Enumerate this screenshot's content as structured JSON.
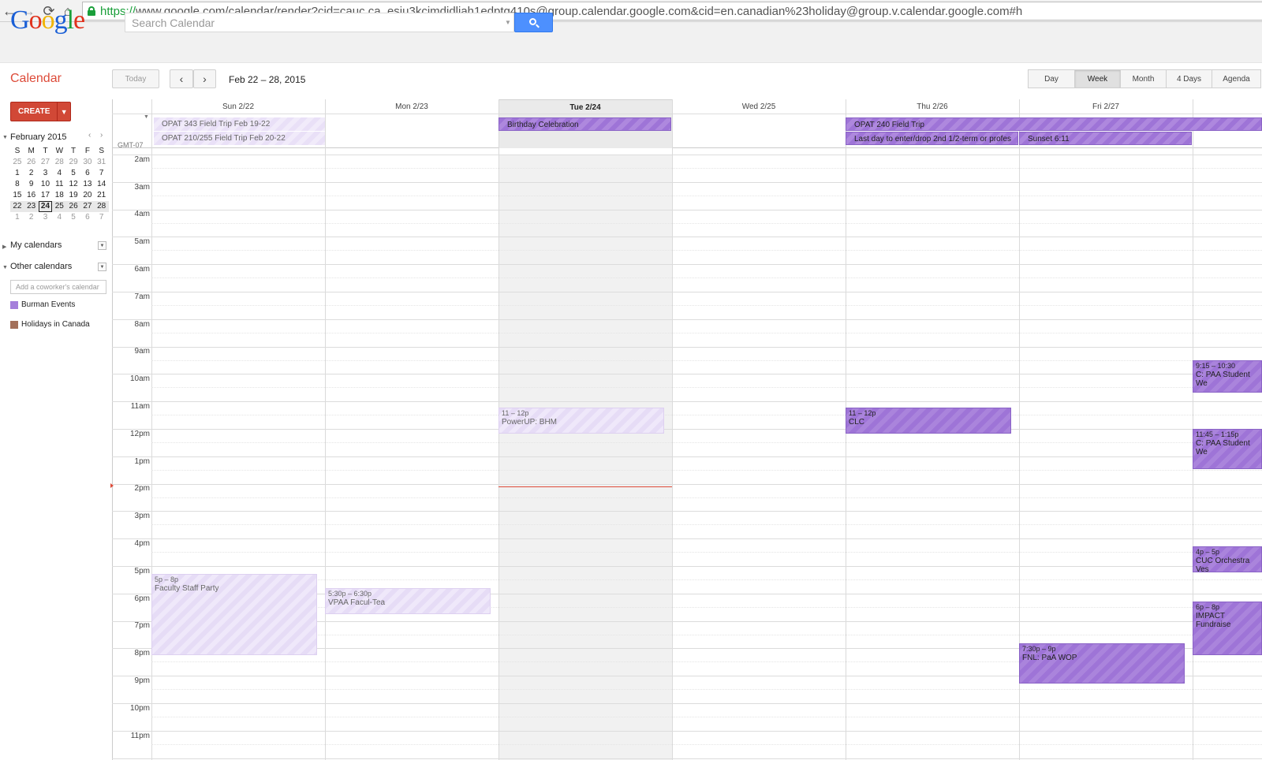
{
  "browser": {
    "url_scheme": "https://",
    "url_rest": "www.google.com/calendar/render?cid=cauc.ca_esju3kcimdjdljah1edptg410s@group.calendar.google.com&cid=en.canadian%23holiday@group.v.calendar.google.com#h",
    "back_icon": "←",
    "forward_icon": "→",
    "reload_icon": "⟳",
    "home_icon": "⌂"
  },
  "header": {
    "logo": [
      "G",
      "o",
      "o",
      "g",
      "l",
      "e"
    ],
    "logo_colors": [
      "#1a5fd6",
      "#e0311c",
      "#f0b400",
      "#1a5fd6",
      "#1a9f3a",
      "#e0311c"
    ],
    "search_placeholder": "Search Calendar"
  },
  "toolbar": {
    "app_title": "Calendar",
    "today": "Today",
    "prev": "‹",
    "next": "›",
    "date_range": "Feb 22 – 28, 2015",
    "views": [
      "Day",
      "Week",
      "Month",
      "4 Days",
      "Agenda"
    ],
    "active_view": "Week"
  },
  "sidebar": {
    "create": "CREATE",
    "create_caret": "▼",
    "mini_month": "February 2015",
    "mini_prev": "‹",
    "mini_next": "›",
    "weekdays": [
      "S",
      "M",
      "T",
      "W",
      "T",
      "F",
      "S"
    ],
    "weeks": [
      [
        "25",
        "26",
        "27",
        "28",
        "29",
        "30",
        "31"
      ],
      [
        "1",
        "2",
        "3",
        "4",
        "5",
        "6",
        "7"
      ],
      [
        "8",
        "9",
        "10",
        "11",
        "12",
        "13",
        "14"
      ],
      [
        "15",
        "16",
        "17",
        "18",
        "19",
        "20",
        "21"
      ],
      [
        "22",
        "23",
        "24",
        "25",
        "26",
        "27",
        "28"
      ],
      [
        "1",
        "2",
        "3",
        "4",
        "5",
        "6",
        "7"
      ]
    ],
    "my_calendars": "My calendars",
    "other_calendars": "Other calendars",
    "cowork_placeholder": "Add a coworker's calendar",
    "calendars": [
      {
        "name": "Burman Events",
        "color": "#a57fdb"
      },
      {
        "name": "Holidays in Canada",
        "color": "#a3705a"
      }
    ]
  },
  "calendar": {
    "day_headers": [
      "Sun 2/22",
      "Mon 2/23",
      "Tue 2/24",
      "Wed 2/25",
      "Thu 2/26",
      "Fri 2/27"
    ],
    "today_index": 2,
    "timezone": "GMT-07",
    "hours": [
      "2am",
      "3am",
      "4am",
      "5am",
      "6am",
      "7am",
      "8am",
      "9am",
      "10am",
      "11am",
      "12pm",
      "1pm",
      "2pm",
      "3pm",
      "4pm",
      "5pm",
      "6pm",
      "7pm",
      "8pm",
      "9pm",
      "10pm",
      "11pm"
    ],
    "allday_events": [
      {
        "title": "OPAT 343 Field Trip Feb 19-22"
      },
      {
        "title": "OPAT 210/255 Field Trip Feb 20-22"
      },
      {
        "title": "Birthday Celebration"
      },
      {
        "title": "OPAT 240 Field Trip"
      },
      {
        "title": "Last day to enter/drop 2nd 1/2-term or profes"
      },
      {
        "title": "Sunset 6:11"
      }
    ],
    "timed_events": [
      {
        "time": "11 – 12p",
        "title": "PowerUP: BHM"
      },
      {
        "time": "11 – 12p",
        "title": "CLC"
      },
      {
        "time": "5p – 8p",
        "title": "Faculty Staff Party"
      },
      {
        "time": "5:30p – 6:30p",
        "title": "VPAA Facul-Tea"
      },
      {
        "time": "7:30p – 9p",
        "title": "FNL: PaA WOP"
      },
      {
        "time": "9:15 – 10:30",
        "title": "C: PAA Student We"
      },
      {
        "time": "11:45 – 1:15p",
        "title": "C: PAA Student We"
      },
      {
        "time": "4p – 5p",
        "title": "CUC Orchestra Ves"
      },
      {
        "time": "6p – 8p",
        "title": "IMPACT Fundraise"
      }
    ]
  }
}
